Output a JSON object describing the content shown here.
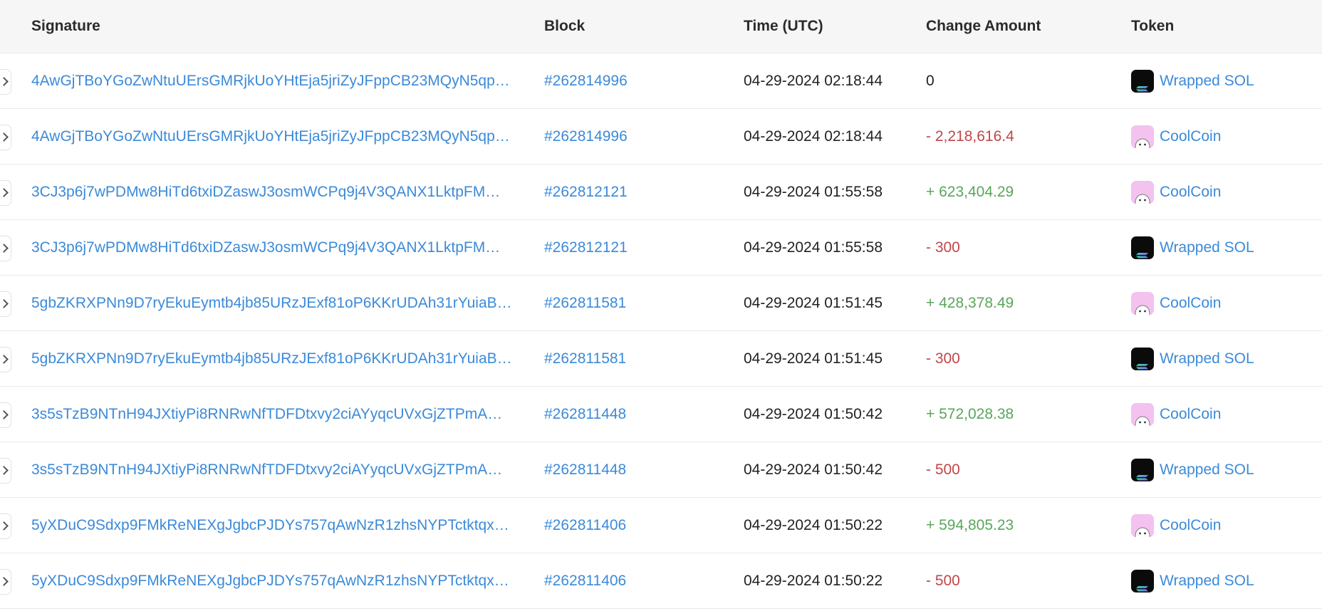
{
  "columns": {
    "signature": "Signature",
    "block": "Block",
    "time": "Time (UTC)",
    "change": "Change Amount",
    "token": "Token"
  },
  "colors": {
    "link": "#3b8ad9",
    "negative": "#c0474a",
    "positive": "#5aa65a",
    "sol_bg": "#0b0b0b",
    "coolcoin_bg": "#f3c2ef"
  },
  "rows": [
    {
      "signature": "4AwGjTBoYGoZwNtuUErsGMRjkUoYHtEja5jriZyJFppCB23MQyN5qp…",
      "block": "#262814996",
      "time": "04-29-2024 02:18:44",
      "change": "0",
      "change_sign": "zero",
      "token": "Wrapped SOL",
      "token_icon": "solana-icon"
    },
    {
      "signature": "4AwGjTBoYGoZwNtuUErsGMRjkUoYHtEja5jriZyJFppCB23MQyN5qp…",
      "block": "#262814996",
      "time": "04-29-2024 02:18:44",
      "change": "- 2,218,616.4",
      "change_sign": "neg",
      "token": "CoolCoin",
      "token_icon": "coolcoin-icon"
    },
    {
      "signature": "3CJ3p6j7wPDMw8HiTd6txiDZaswJ3osmWCPq9j4V3QANX1LktpFM…",
      "block": "#262812121",
      "time": "04-29-2024 01:55:58",
      "change": "+ 623,404.29",
      "change_sign": "pos",
      "token": "CoolCoin",
      "token_icon": "coolcoin-icon"
    },
    {
      "signature": "3CJ3p6j7wPDMw8HiTd6txiDZaswJ3osmWCPq9j4V3QANX1LktpFM…",
      "block": "#262812121",
      "time": "04-29-2024 01:55:58",
      "change": "- 300",
      "change_sign": "neg",
      "token": "Wrapped SOL",
      "token_icon": "solana-icon"
    },
    {
      "signature": "5gbZKRXPNn9D7ryEkuEymtb4jb85URzJExf81oP6KKrUDAh31rYuiaB…",
      "block": "#262811581",
      "time": "04-29-2024 01:51:45",
      "change": "+ 428,378.49",
      "change_sign": "pos",
      "token": "CoolCoin",
      "token_icon": "coolcoin-icon"
    },
    {
      "signature": "5gbZKRXPNn9D7ryEkuEymtb4jb85URzJExf81oP6KKrUDAh31rYuiaB…",
      "block": "#262811581",
      "time": "04-29-2024 01:51:45",
      "change": "- 300",
      "change_sign": "neg",
      "token": "Wrapped SOL",
      "token_icon": "solana-icon"
    },
    {
      "signature": "3s5sTzB9NTnH94JXtiyPi8RNRwNfTDFDtxvy2ciAYyqcUVxGjZTPmA…",
      "block": "#262811448",
      "time": "04-29-2024 01:50:42",
      "change": "+ 572,028.38",
      "change_sign": "pos",
      "token": "CoolCoin",
      "token_icon": "coolcoin-icon"
    },
    {
      "signature": "3s5sTzB9NTnH94JXtiyPi8RNRwNfTDFDtxvy2ciAYyqcUVxGjZTPmA…",
      "block": "#262811448",
      "time": "04-29-2024 01:50:42",
      "change": "- 500",
      "change_sign": "neg",
      "token": "Wrapped SOL",
      "token_icon": "solana-icon"
    },
    {
      "signature": "5yXDuC9Sdxp9FMkReNEXgJgbcPJDYs757qAwNzR1zhsNYPTctktqx…",
      "block": "#262811406",
      "time": "04-29-2024 01:50:22",
      "change": "+ 594,805.23",
      "change_sign": "pos",
      "token": "CoolCoin",
      "token_icon": "coolcoin-icon"
    },
    {
      "signature": "5yXDuC9Sdxp9FMkReNEXgJgbcPJDYs757qAwNzR1zhsNYPTctktqx…",
      "block": "#262811406",
      "time": "04-29-2024 01:50:22",
      "change": "- 500",
      "change_sign": "neg",
      "token": "Wrapped SOL",
      "token_icon": "solana-icon"
    }
  ]
}
